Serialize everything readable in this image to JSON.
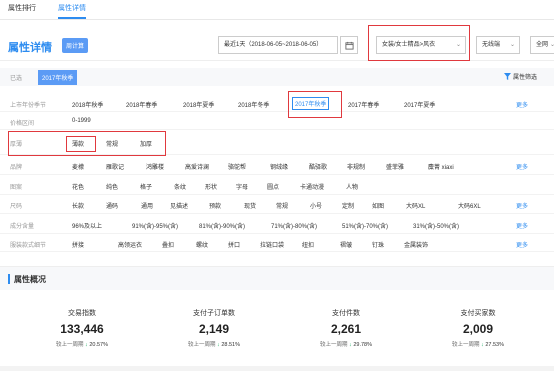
{
  "tabs": [
    "属性排行",
    "属性详情"
  ],
  "header": {
    "title": "属性详情",
    "tag": "周计算",
    "date_range": "最近1天（2018-06-05~2018-06-05）",
    "category": "女装/女士精品>风衣",
    "channel": "无线端",
    "scope": "全网"
  },
  "selected": {
    "label": "已选",
    "chip": "2017年秋季",
    "filter_label": "属性筛选"
  },
  "filters": [
    {
      "label": "上市年份季节",
      "options": [
        "2018年秋季",
        "2018年春季",
        "2018年夏季",
        "2018年冬季",
        "2017年秋季",
        "2017年春季",
        "2017年夏季"
      ],
      "more": "更多"
    },
    {
      "label": "价格区间",
      "options": [
        "0-1999"
      ],
      "more": ""
    },
    {
      "label": "厚薄",
      "options": [
        "薄款",
        "常规",
        "加厚"
      ],
      "more": ""
    },
    {
      "label": "品牌",
      "options": [
        "麦檬",
        "雁歌记",
        "鸿雕楼",
        "高爱诗澜",
        "骆鸵帮",
        "钢绒缘",
        "酷驿歌",
        "非规制",
        "盛菲雅",
        "麋菁 xiaxi"
      ],
      "more": "更多"
    },
    {
      "label": "图案",
      "options": [
        "花色",
        "纯色",
        "格子",
        "条纹",
        "形状",
        "字母",
        "圆点",
        "卡通动漫",
        "人物"
      ],
      "more": ""
    },
    {
      "label": "尺码",
      "options": [
        "长款",
        "通码",
        "通用",
        "见描述",
        "预款",
        "现货",
        "常规",
        "小号",
        "定制",
        "如图",
        "大码XL",
        "大码6XL"
      ],
      "more": "更多"
    },
    {
      "label": "成分含量",
      "options": [
        "96%及以上",
        "91%(含)-95%(含)",
        "81%(含)-90%(含)",
        "71%(含)-80%(含)",
        "51%(含)-70%(含)",
        "31%(含)-50%(含)"
      ],
      "more": "更多"
    },
    {
      "label": "服装款式细节",
      "options": [
        "拼接",
        "高领运衣",
        "叠扣",
        "螺纹",
        "拼口",
        "拉链口袋",
        "纽扣",
        "褶皱",
        "钉珠",
        "金属装饰"
      ],
      "more": "更多"
    }
  ],
  "overview": {
    "title": "属性概况"
  },
  "metrics": [
    {
      "label": "交易指数",
      "value": "133,446",
      "compare": "较上一周期",
      "pct": "20.57%"
    },
    {
      "label": "支付子订单数",
      "value": "2,149",
      "compare": "较上一周期",
      "pct": "28.51%"
    },
    {
      "label": "支付件数",
      "value": "2,261",
      "compare": "较上一周期",
      "pct": "29.78%"
    },
    {
      "label": "支付买家数",
      "value": "2,009",
      "compare": "较上一周期",
      "pct": "27.53%"
    }
  ],
  "colors": {
    "accent": "#2d8cf0",
    "highlight": "#e0393e",
    "down": "#27b06b"
  }
}
